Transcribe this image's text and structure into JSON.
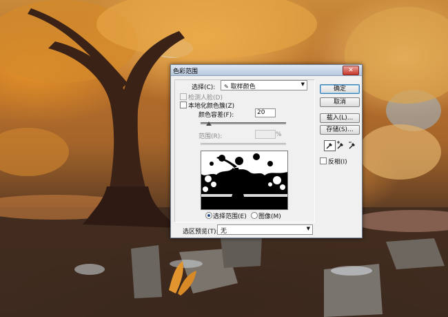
{
  "dialog": {
    "title": "色彩范围",
    "close_glyph": "✕",
    "select_label": "选择(C):",
    "select_value": "取样颜色",
    "detect_faces_label": "检测人脸(D)",
    "localized_clusters_label": "本地化颜色簇(Z)",
    "fuzziness_label": "颜色容差(F):",
    "fuzziness_value": "20",
    "range_label": "范围(R):",
    "range_value": "",
    "range_unit": "%",
    "radio_selection_label": "选择范围(E)",
    "radio_image_label": "图像(M)",
    "preview_label": "选区预览(T):",
    "preview_value": "无",
    "invert_label": "反相(I)"
  },
  "buttons": {
    "ok": "确定",
    "cancel": "取消",
    "load": "载入(L)...",
    "save": "存储(S)..."
  },
  "state": {
    "fuzziness_slider_fraction": 0.1,
    "detect_faces_checked": false,
    "localized_clusters_checked": false,
    "invert_checked": false,
    "selected_radio": "selection",
    "selected_eyedropper": "eyedropper"
  },
  "icons": {
    "eyedropper": "eyedropper-icon",
    "eyedropper_add": "eyedropper-add-icon",
    "eyedropper_subtract": "eyedropper-subtract-icon"
  },
  "colors": {
    "titlebar_close": "#c8372a",
    "foliage": "#d8902f"
  }
}
